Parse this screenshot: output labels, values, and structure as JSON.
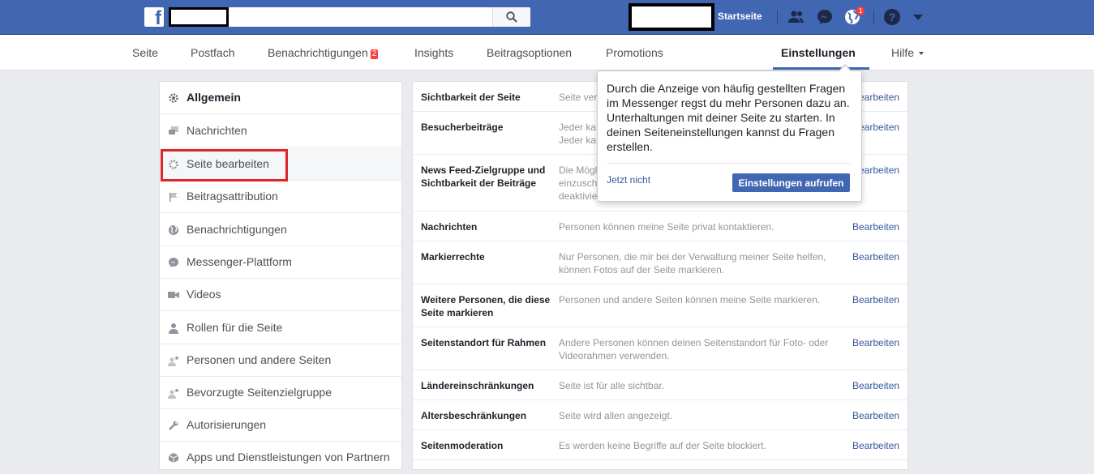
{
  "topbar": {
    "logo_letter": "f",
    "search_placeholder": "",
    "home_label": "Startseite",
    "notification_count": "1",
    "icons": [
      "facebook-logo-icon",
      "search-icon",
      "friend-requests-icon",
      "messenger-icon",
      "globe-notifications-icon",
      "help-icon",
      "caret-down-icon"
    ]
  },
  "pagenav": {
    "items": [
      {
        "label": "Seite"
      },
      {
        "label": "Postfach"
      },
      {
        "label": "Benachrichtigungen",
        "badge": "2"
      },
      {
        "label": "Insights"
      },
      {
        "label": "Beitragsoptionen"
      },
      {
        "label": "Promotions"
      },
      {
        "label": "Einstellungen"
      },
      {
        "label": "Hilfe"
      }
    ],
    "active": "Einstellungen"
  },
  "leftmenu": {
    "items": [
      {
        "label": "Allgemein",
        "icon": "gear-icon"
      },
      {
        "label": "Nachrichten",
        "icon": "chat-bubbles-icon"
      },
      {
        "label": "Seite bearbeiten",
        "icon": "gear-icon"
      },
      {
        "label": "Beitragsattribution",
        "icon": "flag-icon"
      },
      {
        "label": "Benachrichtigungen",
        "icon": "globe-icon"
      },
      {
        "label": "Messenger-Plattform",
        "icon": "messenger-icon"
      },
      {
        "label": "Videos",
        "icon": "video-camera-icon"
      },
      {
        "label": "Rollen für die Seite",
        "icon": "person-icon"
      },
      {
        "label": "Personen und andere Seiten",
        "icon": "person-star-icon"
      },
      {
        "label": "Bevorzugte Seitenzielgruppe",
        "icon": "person-star-icon"
      },
      {
        "label": "Autorisierungen",
        "icon": "wrench-icon"
      },
      {
        "label": "Apps und Dienstleistungen von Partnern",
        "icon": "box-icon"
      }
    ]
  },
  "settings": {
    "edit_label": "Bearbeiten",
    "rows": [
      {
        "title": "Sichtbarkeit der Seite",
        "desc": "Seite ver"
      },
      {
        "title": "Besucherbeiträge",
        "desc": "Jeder ka\nJeder ka"
      },
      {
        "title": "News Feed-Zielgruppe und Sichtbarkeit der Beiträge",
        "desc": "Die Mögl\neinzusch\ndeaktivie"
      },
      {
        "title": "Nachrichten",
        "desc": "Personen können meine Seite privat kontaktieren."
      },
      {
        "title": "Markierrechte",
        "desc": "Nur Personen, die mir bei der Verwaltung meiner Seite helfen, können Fotos auf der Seite markieren."
      },
      {
        "title": "Weitere Personen, die diese Seite markieren",
        "desc": "Personen und andere Seiten können meine Seite markieren."
      },
      {
        "title": "Seitenstandort für Rahmen",
        "desc": "Andere Personen können deinen Seitenstandort für Foto- oder Videorahmen verwenden."
      },
      {
        "title": "Ländereinschränkungen",
        "desc": "Seite ist für alle sichtbar."
      },
      {
        "title": "Altersbeschränkungen",
        "desc": "Seite wird allen angezeigt."
      },
      {
        "title": "Seitenmoderation",
        "desc": "Es werden keine Begriffe auf der Seite blockiert."
      }
    ]
  },
  "popover": {
    "text": "Durch die Anzeige von häufig gestellten Fragen im Messenger regst du mehr Personen dazu an. Unterhaltungen mit deiner Seite zu starten. In deinen Seiteneinstellungen kannst du Fragen erstellen.",
    "dismiss_label": "Jetzt nicht",
    "cta_label": "Einstellungen aufrufen"
  },
  "colors": {
    "brand_blue": "#4267b2",
    "link_blue": "#365899",
    "highlight_red": "#e0242b",
    "badge_red": "#fa3e3e"
  }
}
